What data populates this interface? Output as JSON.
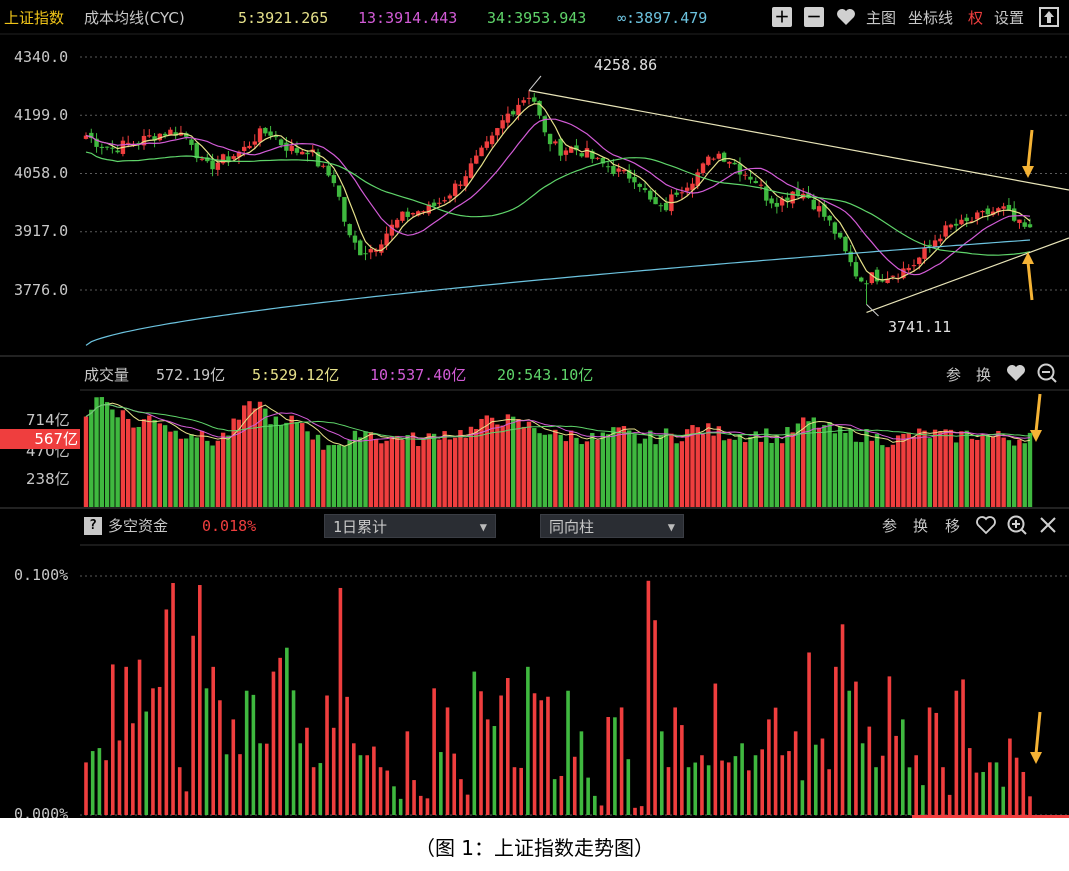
{
  "main_panel": {
    "index_name": "上证指数",
    "indicator_name": "成本均线(CYC)",
    "ma_values": [
      {
        "label": "5:3921.265",
        "color": "#e6e18a"
      },
      {
        "label": "13:3914.443",
        "color": "#d25bd6"
      },
      {
        "label": "34:3953.943",
        "color": "#5fd46a"
      },
      {
        "label": "∞:3897.479",
        "color": "#6cc3df"
      }
    ],
    "toolbar": {
      "zoom_in": "＋",
      "zoom_out": "－",
      "main_chart": "主图",
      "axis": "坐标线",
      "rights": "权",
      "settings": "设置"
    },
    "y_ticks": [
      "4340.0",
      "4199.0",
      "4058.0",
      "3917.0",
      "3776.0"
    ],
    "high_label": "4258.86",
    "low_label": "3741.11"
  },
  "volume_panel": {
    "title": "成交量",
    "value": "572.19亿",
    "ma_values": [
      {
        "label": "5:529.12亿",
        "color": "#e6e18a"
      },
      {
        "label": "10:537.40亿",
        "color": "#d25bd6"
      },
      {
        "label": "20:543.10亿",
        "color": "#5fd46a"
      }
    ],
    "y_ticks": [
      "714亿",
      "470亿",
      "238亿"
    ],
    "current_tag": "567亿",
    "buttons": {
      "param": "参",
      "switch": "换"
    }
  },
  "fund_panel": {
    "help": "?",
    "title": "多空资金",
    "value": "0.018%",
    "period_select": "1日累计",
    "style_select": "同向柱",
    "buttons": {
      "param": "参",
      "switch": "换",
      "move": "移"
    },
    "y_ticks": [
      "0.100%",
      "0.000%"
    ]
  },
  "colors": {
    "up": "#ef3e3e",
    "down": "#3fb83f",
    "bg": "#000000",
    "grid": "#5a5a5a"
  },
  "caption": "（图 1：上证指数走势图）",
  "chart_data": [
    {
      "type": "candlestick",
      "title": "上证指数",
      "ylim": [
        3700,
        4360
      ],
      "y_ticks": [
        4340.0,
        4199.0,
        4058.0,
        3917.0,
        3776.0
      ],
      "annotations": [
        {
          "text": "4258.86",
          "value": 4258.86
        },
        {
          "text": "3741.11",
          "value": 3741.11
        }
      ],
      "close_anchors": [
        4150,
        4130,
        4118,
        4128,
        4135,
        4148,
        4158,
        4160,
        4140,
        4070,
        4085,
        4098,
        4115,
        4150,
        4160,
        4128,
        4112,
        4118,
        4068,
        4040,
        3905,
        3868,
        3880,
        3918,
        3950,
        3965,
        3970,
        3990,
        4020,
        4060,
        4100,
        4140,
        4195,
        4230,
        4255,
        4150,
        4115,
        4120,
        4110,
        4085,
        4072,
        4055,
        4050,
        3990,
        3965,
        4015,
        4040,
        4070,
        4110,
        4095,
        4065,
        4045,
        3998,
        3990,
        4020,
        4005,
        3968,
        3925,
        3858,
        3800,
        3808,
        3812,
        3820,
        3835,
        3868,
        3908,
        3930,
        3935,
        3950,
        3965,
        3970,
        3935,
        3918
      ]
    },
    {
      "type": "bar",
      "title": "成交量",
      "ylim": [
        0,
        880
      ],
      "y_ticks": [
        714,
        470,
        238
      ],
      "series": [
        {
          "name": "成交量",
          "values_anchors": [
            720,
            860,
            780,
            700,
            610,
            720,
            650,
            560,
            600,
            520,
            510,
            590,
            720,
            820,
            700,
            600,
            680,
            610,
            470,
            520,
            450,
            610,
            560,
            510,
            560,
            520,
            520,
            580,
            560,
            580,
            610,
            700,
            670,
            640,
            620,
            590,
            540,
            560,
            540,
            520,
            560,
            580,
            520,
            530,
            560,
            540,
            600,
            600,
            580,
            560,
            560,
            560,
            560,
            520,
            600,
            660,
            640,
            580,
            560,
            560,
            540,
            520,
            520,
            560,
            560,
            560,
            540,
            560,
            560,
            540,
            540,
            520,
            572
          ]
        }
      ]
    },
    {
      "type": "bar",
      "title": "多空资金",
      "ylim": [
        0,
        0.1
      ],
      "y_ticks": [
        0.1,
        0.0
      ],
      "series": [
        {
          "name": "多空资金",
          "values_anchors": [
            0.022,
            0.028,
            0.063,
            0.062,
            0.065,
            0.053,
            0.086,
            0.02,
            0.075,
            0.053,
            0.048,
            0.04,
            0.052,
            0.03,
            0.06,
            0.07,
            0.03,
            0.02,
            0.05,
            0.095,
            0.03,
            0.025,
            0.02,
            0.012,
            0.035,
            0.008,
            0.053,
            0.045,
            0.015,
            0.06,
            0.04,
            0.05,
            0.02,
            0.062,
            0.048,
            0.015,
            0.052,
            0.035,
            0.008,
            0.041,
            0.045,
            0.003,
            0.098,
            0.035,
            0.045,
            0.02,
            0.025,
            0.055,
            0.022,
            0.03,
            0.025,
            0.04,
            0.025,
            0.035,
            0.068,
            0.032,
            0.062,
            0.052,
            0.03,
            0.02,
            0.058,
            0.04,
            0.025,
            0.045,
            0.02,
            0.052,
            0.028,
            0.018,
            0.022,
            0.032,
            0.018
          ]
        }
      ]
    }
  ]
}
